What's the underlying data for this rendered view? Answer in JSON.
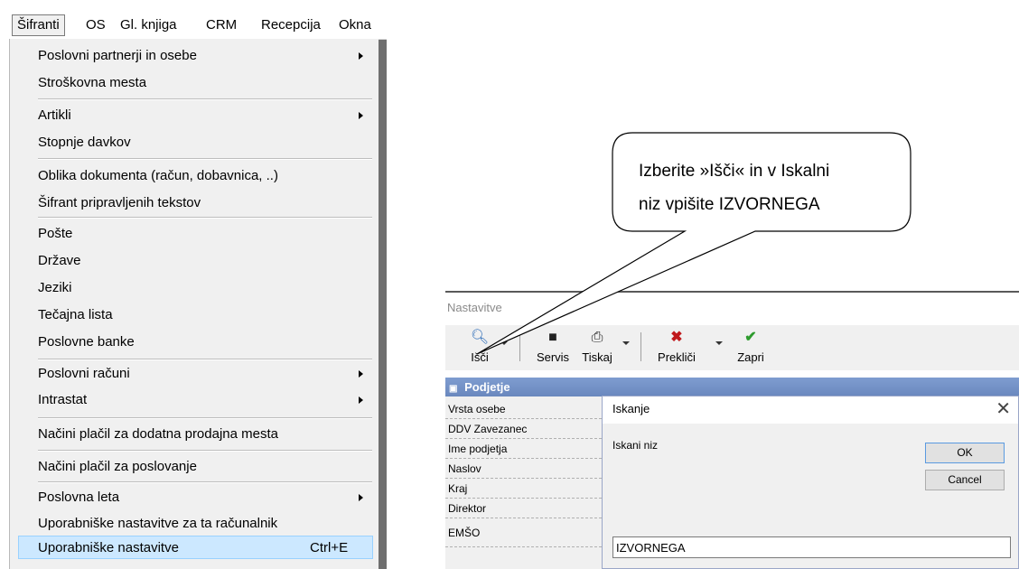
{
  "menubar": {
    "items": [
      "Šifranti",
      "OS",
      "Gl. knjiga",
      "CRM",
      "Recepcija",
      "Okna"
    ]
  },
  "menu": {
    "items": [
      {
        "label": "Poslovni partnerji in osebe",
        "submenu": true
      },
      {
        "label": "Stroškovna mesta",
        "submenu": false
      },
      {
        "label": "Artikli",
        "submenu": true
      },
      {
        "label": "Stopnje davkov",
        "submenu": false
      },
      {
        "label": "Oblika dokumenta (račun, dobavnica, ..)",
        "submenu": false
      },
      {
        "label": "Šifrant pripravljenih tekstov",
        "submenu": false
      },
      {
        "label": "Pošte",
        "submenu": false
      },
      {
        "label": "Države",
        "submenu": false
      },
      {
        "label": "Jeziki",
        "submenu": false
      },
      {
        "label": "Tečajna lista",
        "submenu": false
      },
      {
        "label": "Poslovne banke",
        "submenu": false
      },
      {
        "label": "Poslovni računi",
        "submenu": true
      },
      {
        "label": "Intrastat",
        "submenu": true
      },
      {
        "label": "Načini plačil za dodatna prodajna mesta",
        "submenu": false
      },
      {
        "label": "Načini plačil za poslovanje",
        "submenu": false
      },
      {
        "label": "Poslovna leta",
        "submenu": true
      },
      {
        "label": "Uporabniške nastavitve za ta računalnik",
        "submenu": false
      },
      {
        "label": "Uporabniške nastavitve",
        "submenu": false,
        "shortcut": "Ctrl+E",
        "highlighted": true
      }
    ]
  },
  "callout": {
    "line1": "Izberite »Išči« in v Iskalni",
    "line2": "niz vpišite IZVORNEGA"
  },
  "window": {
    "title": "Nastavitve",
    "toolbar": {
      "isci": "Išči",
      "servis": "Servis",
      "tiskaj": "Tiskaj",
      "preklici": "Prekliči",
      "zapri": "Zapri"
    },
    "section_header": "Podjetje",
    "rows": [
      "Vrsta osebe",
      "DDV Zavezanec",
      "Ime podjetja",
      "Naslov",
      "Kraj",
      "Direktor",
      "EMŠO"
    ]
  },
  "dialog": {
    "title": "Iskanje",
    "close": "✕",
    "label": "Iskani niz",
    "ok": "OK",
    "cancel": "Cancel",
    "input_value": "IZVORNEGA"
  }
}
